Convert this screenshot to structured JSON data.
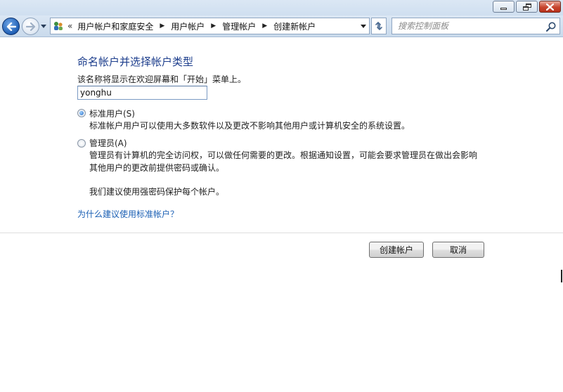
{
  "breadcrumb": {
    "overflow": "«",
    "items": [
      "用户帐户和家庭安全",
      "用户帐户",
      "管理帐户",
      "创建新帐户"
    ]
  },
  "search": {
    "placeholder": "搜索控制面板"
  },
  "main": {
    "title": "命名帐户并选择帐户类型",
    "description": "该名称将显示在欢迎屏幕和「开始」菜单上。",
    "name_value": "yonghu",
    "options": [
      {
        "label": "标准用户(S)",
        "description": "标准帐户用户可以使用大多数软件以及更改不影响其他用户或计算机安全的系统设置。",
        "selected": true
      },
      {
        "label": "管理员(A)",
        "description_lines": [
          "管理员有计算机的完全访问权，可以做任何需要的更改。根据通知设置，可能会要求管理员在做出会影响",
          "其他用户的更改前提供密码或确认。"
        ],
        "selected": false
      }
    ],
    "recommendation": "我们建议使用强密码保护每个帐户。",
    "help_link": "为什么建议使用标准帐户？"
  },
  "buttons": {
    "create": "创建帐户",
    "cancel": "取消"
  },
  "colors": {
    "title": "#1c3d8c",
    "link": "#1a5fb4",
    "nav_bar": "#c9daec"
  },
  "icons": [
    "minimize-icon",
    "maximize-icon",
    "close-icon",
    "back-arrow-icon",
    "forward-arrow-icon",
    "control-panel-icon",
    "refresh-icon",
    "search-icon"
  ]
}
